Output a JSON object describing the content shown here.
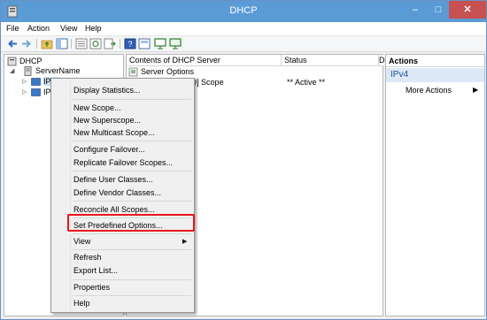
{
  "window": {
    "title": "DHCP"
  },
  "menubar": {
    "file": "File",
    "action": "Action",
    "view": "View",
    "help": "Help"
  },
  "tree": {
    "root": "DHCP",
    "server": "ServerName",
    "ipv4": "IPv4",
    "ipv6": "IPv6"
  },
  "center": {
    "col_contents": "Contents of DHCP Server",
    "col_status": "Status",
    "col_d": "D",
    "rows": [
      {
        "name": "Server Options",
        "status": ""
      },
      {
        "name": "Scope [10.0.0.0] Scope",
        "status": "** Active **"
      }
    ]
  },
  "actions": {
    "header": "Actions",
    "section": "IPv4",
    "more": "More Actions"
  },
  "context_menu": {
    "display_statistics": "Display Statistics...",
    "new_scope": "New Scope...",
    "new_superscope": "New Superscope...",
    "new_multicast_scope": "New Multicast Scope...",
    "configure_failover": "Configure Failover...",
    "replicate_failover": "Replicate Failover Scopes...",
    "define_user_classes": "Define User Classes...",
    "define_vendor_classes": "Define Vendor Classes...",
    "reconcile_all_scopes": "Reconcile All Scopes...",
    "set_predefined_options": "Set Predefined Options...",
    "view": "View",
    "refresh": "Refresh",
    "export_list": "Export List...",
    "properties": "Properties",
    "help": "Help"
  },
  "colors": {
    "titlebar": "#5b9bd5",
    "close": "#c75050",
    "highlight_box": "#e8141c",
    "actions_section": "#dde9f7"
  }
}
